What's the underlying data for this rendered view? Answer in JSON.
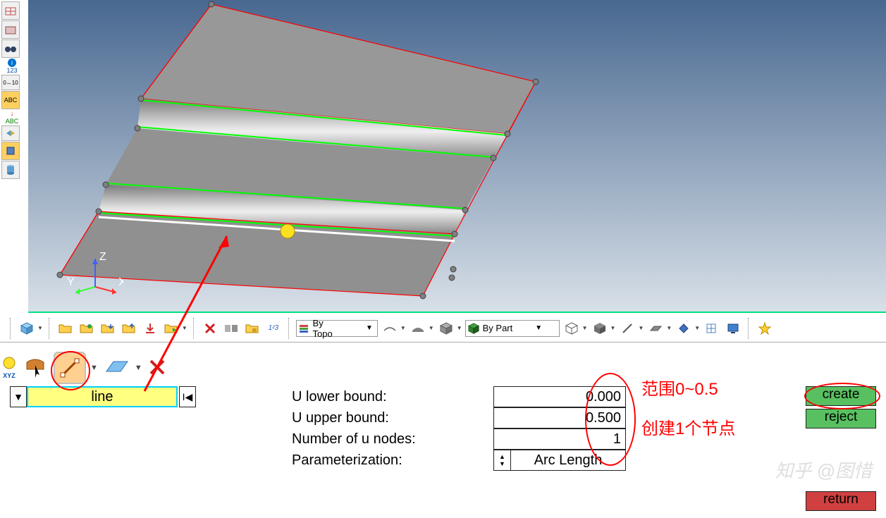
{
  "viewport": {
    "axes": {
      "x": "X",
      "y": "Y",
      "z": "Z"
    }
  },
  "left_toolbar": {
    "items": [
      {
        "name": "grid-perspective",
        "icon": "grid"
      },
      {
        "name": "grid-unshaded",
        "icon": "grid"
      },
      {
        "name": "binoculars",
        "icon": "binoc"
      },
      {
        "name": "info-123",
        "label": "123",
        "icon": "info"
      },
      {
        "name": "measure-0-10",
        "icon": "ruler"
      },
      {
        "name": "abc-yellow",
        "label": "ABC",
        "icon": "abc"
      },
      {
        "name": "abc-green",
        "label": "ABC",
        "icon": "abc"
      },
      {
        "name": "color-toggle",
        "icon": "arrows"
      },
      {
        "name": "rectangle-select",
        "icon": "rect"
      },
      {
        "name": "cylinder-primitive",
        "icon": "cyl"
      }
    ]
  },
  "main_toolbar": {
    "selector_icon": "iso",
    "file_ops": [
      "open",
      "save",
      "import",
      "export",
      "load",
      "run"
    ],
    "edit_ops": [
      "delete-x",
      "replace",
      "organize",
      "renumber"
    ],
    "topology_dropdown": {
      "label": "By Topo",
      "icon": "layers"
    },
    "view_ops": [
      "hidden-line",
      "shaded",
      "iso-view"
    ],
    "part_dropdown": {
      "label": "By Part",
      "icon": "cube"
    },
    "display_ops": [
      "wireframe-cube",
      "shaded-cube",
      "line",
      "plane",
      "diamond",
      "mesh-check",
      "monitor"
    ],
    "favorite": "star"
  },
  "secondary_toolbar": {
    "items": [
      {
        "name": "xyz-nodes",
        "label": "XYZ"
      },
      {
        "name": "cursor-select"
      },
      {
        "name": "line-tool",
        "active": true
      },
      {
        "name": "surface-tool"
      },
      {
        "name": "delete-x"
      }
    ]
  },
  "selection": {
    "current": "line",
    "dropdown_icon": "▼",
    "reset_icon": "I◀"
  },
  "params": {
    "labels": {
      "u_lower": "U lower bound:",
      "u_upper": "U upper bound:",
      "num_u": "Number of u nodes:",
      "param": "Parameterization:"
    },
    "values": {
      "u_lower": "0.000",
      "u_upper": "0.500",
      "num_u": "1",
      "param_mode": "Arc Length"
    }
  },
  "actions": {
    "create": "create",
    "reject": "reject",
    "return": "return"
  },
  "annotations": {
    "range": "范围0~0.5",
    "create_node": "创建1个节点"
  },
  "watermark": "知乎 @图惜"
}
